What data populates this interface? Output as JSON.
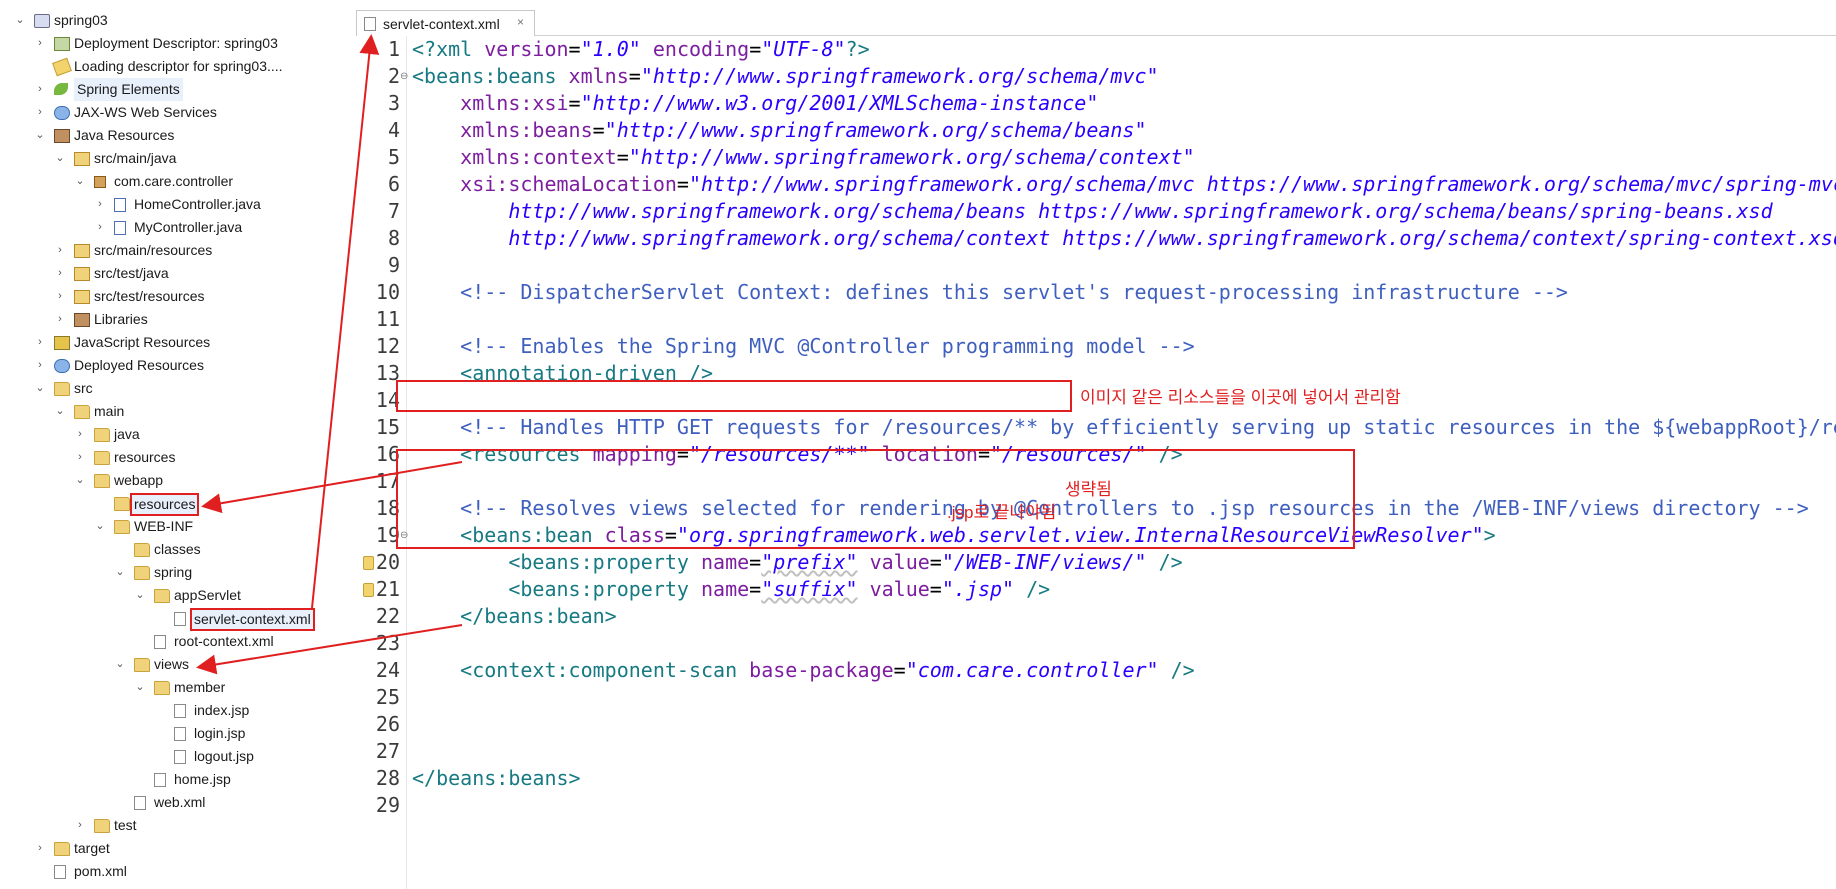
{
  "explorer": {
    "items": [
      {
        "label": "spring03",
        "depth": 0,
        "chev": "v",
        "icon": "project"
      },
      {
        "label": "Deployment Descriptor: spring03",
        "depth": 1,
        "chev": ">",
        "icon": "desc"
      },
      {
        "label": "Loading descriptor for spring03....",
        "depth": 1,
        "chev": "",
        "icon": "warn"
      },
      {
        "label": "Spring Elements",
        "depth": 1,
        "chev": ">",
        "icon": "leaf",
        "selected": true
      },
      {
        "label": "JAX-WS Web Services",
        "depth": 1,
        "chev": ">",
        "icon": "globe"
      },
      {
        "label": "Java Resources",
        "depth": 1,
        "chev": "v",
        "icon": "lib"
      },
      {
        "label": "src/main/java",
        "depth": 2,
        "chev": "v",
        "icon": "srcfolder"
      },
      {
        "label": "com.care.controller",
        "depth": 3,
        "chev": "v",
        "icon": "package"
      },
      {
        "label": "HomeController.java",
        "depth": 4,
        "chev": ">",
        "icon": "java"
      },
      {
        "label": "MyController.java",
        "depth": 4,
        "chev": ">",
        "icon": "java"
      },
      {
        "label": "src/main/resources",
        "depth": 2,
        "chev": ">",
        "icon": "srcfolder"
      },
      {
        "label": "src/test/java",
        "depth": 2,
        "chev": ">",
        "icon": "srcfolder"
      },
      {
        "label": "src/test/resources",
        "depth": 2,
        "chev": ">",
        "icon": "srcfolder"
      },
      {
        "label": "Libraries",
        "depth": 2,
        "chev": ">",
        "icon": "lib"
      },
      {
        "label": "JavaScript Resources",
        "depth": 1,
        "chev": ">",
        "icon": "jsres"
      },
      {
        "label": "Deployed Resources",
        "depth": 1,
        "chev": ">",
        "icon": "globe"
      },
      {
        "label": "src",
        "depth": 1,
        "chev": "v",
        "icon": "folder"
      },
      {
        "label": "main",
        "depth": 2,
        "chev": "v",
        "icon": "folder"
      },
      {
        "label": "java",
        "depth": 3,
        "chev": ">",
        "icon": "folder"
      },
      {
        "label": "resources",
        "depth": 3,
        "chev": ">",
        "icon": "folder"
      },
      {
        "label": "webapp",
        "depth": 3,
        "chev": "v",
        "icon": "folder"
      },
      {
        "label": "resources",
        "depth": 4,
        "chev": "",
        "icon": "folder",
        "highlight": true
      },
      {
        "label": "WEB-INF",
        "depth": 4,
        "chev": "v",
        "icon": "folder"
      },
      {
        "label": "classes",
        "depth": 5,
        "chev": "",
        "icon": "folder"
      },
      {
        "label": "spring",
        "depth": 5,
        "chev": "v",
        "icon": "folder"
      },
      {
        "label": "appServlet",
        "depth": 6,
        "chev": "v",
        "icon": "folder"
      },
      {
        "label": "servlet-context.xml",
        "depth": 7,
        "chev": "",
        "icon": "xml",
        "highlight": true
      },
      {
        "label": "root-context.xml",
        "depth": 6,
        "chev": "",
        "icon": "xml"
      },
      {
        "label": "views",
        "depth": 5,
        "chev": "v",
        "icon": "folder"
      },
      {
        "label": "member",
        "depth": 6,
        "chev": "v",
        "icon": "folder"
      },
      {
        "label": "index.jsp",
        "depth": 7,
        "chev": "",
        "icon": "jsp"
      },
      {
        "label": "login.jsp",
        "depth": 7,
        "chev": "",
        "icon": "jsp"
      },
      {
        "label": "logout.jsp",
        "depth": 7,
        "chev": "",
        "icon": "jsp"
      },
      {
        "label": "home.jsp",
        "depth": 6,
        "chev": "",
        "icon": "jsp"
      },
      {
        "label": "web.xml",
        "depth": 5,
        "chev": "",
        "icon": "xml"
      },
      {
        "label": "test",
        "depth": 3,
        "chev": ">",
        "icon": "folder"
      },
      {
        "label": "target",
        "depth": 1,
        "chev": ">",
        "icon": "folder"
      },
      {
        "label": "pom.xml",
        "depth": 1,
        "chev": "",
        "icon": "xml"
      }
    ]
  },
  "editor": {
    "tab_label": "servlet-context.xml",
    "tab_close": "×",
    "lines": [
      {
        "n": "1",
        "parts": [
          [
            "tag",
            "<?xml "
          ],
          [
            "attr",
            "version"
          ],
          [
            "eq",
            "="
          ],
          [
            "val",
            "\"1.0\""
          ],
          [
            "eq",
            " "
          ],
          [
            "attr",
            "encoding"
          ],
          [
            "eq",
            "="
          ],
          [
            "val",
            "\"UTF-8\""
          ],
          [
            "tag",
            "?>"
          ]
        ]
      },
      {
        "n": "2",
        "fold": "⊖",
        "parts": [
          [
            "tag",
            "<beans:beans "
          ],
          [
            "attr",
            "xmlns"
          ],
          [
            "eq",
            "="
          ],
          [
            "val",
            "\"http://www.springframework.org/schema/mvc\""
          ]
        ]
      },
      {
        "n": "3",
        "parts": [
          [
            "eq",
            "    "
          ],
          [
            "attr",
            "xmlns:xsi"
          ],
          [
            "eq",
            "="
          ],
          [
            "val",
            "\"http://www.w3.org/2001/XMLSchema-instance\""
          ]
        ]
      },
      {
        "n": "4",
        "parts": [
          [
            "eq",
            "    "
          ],
          [
            "attr",
            "xmlns:beans"
          ],
          [
            "eq",
            "="
          ],
          [
            "val",
            "\"http://www.springframework.org/schema/beans\""
          ]
        ]
      },
      {
        "n": "5",
        "parts": [
          [
            "eq",
            "    "
          ],
          [
            "attr",
            "xmlns:context"
          ],
          [
            "eq",
            "="
          ],
          [
            "val",
            "\"http://www.springframework.org/schema/context\""
          ]
        ]
      },
      {
        "n": "6",
        "parts": [
          [
            "eq",
            "    "
          ],
          [
            "attr",
            "xsi:schemaLocation"
          ],
          [
            "eq",
            "="
          ],
          [
            "val",
            "\"http://www.springframework.org/schema/mvc https://www.springframework.org/schema/mvc/spring-mvc.xsd"
          ]
        ]
      },
      {
        "n": "7",
        "parts": [
          [
            "val",
            "        http://www.springframework.org/schema/beans https://www.springframework.org/schema/beans/spring-beans.xsd"
          ]
        ]
      },
      {
        "n": "8",
        "parts": [
          [
            "val",
            "        http://www.springframework.org/schema/context https://www.springframework.org/schema/context/spring-context.xsd\">"
          ]
        ]
      },
      {
        "n": "9",
        "parts": []
      },
      {
        "n": "10",
        "parts": [
          [
            "cmt",
            "    <!-- DispatcherServlet Context: defines this servlet's request-processing infrastructure -->"
          ]
        ]
      },
      {
        "n": "11",
        "parts": []
      },
      {
        "n": "12",
        "parts": [
          [
            "cmt",
            "    <!-- Enables the Spring MVC @Controller programming model -->"
          ]
        ]
      },
      {
        "n": "13",
        "parts": [
          [
            "tag",
            "    <annotation-driven />"
          ]
        ]
      },
      {
        "n": "14",
        "parts": []
      },
      {
        "n": "15",
        "parts": [
          [
            "cmt",
            "    <!-- Handles HTTP GET requests for /resources/** by efficiently serving up static resources in the ${webappRoot}/resources directory -->"
          ]
        ]
      },
      {
        "n": "16",
        "parts": [
          [
            "tag",
            "    <resources "
          ],
          [
            "attr",
            "mapping"
          ],
          [
            "eq",
            "="
          ],
          [
            "val",
            "\"/resources/**\""
          ],
          [
            "eq",
            " "
          ],
          [
            "attr",
            "location"
          ],
          [
            "eq",
            "="
          ],
          [
            "val",
            "\"/resources/\""
          ],
          [
            "tag",
            " />"
          ]
        ]
      },
      {
        "n": "17",
        "parts": []
      },
      {
        "n": "18",
        "parts": [
          [
            "cmt",
            "    <!-- Resolves views selected for rendering by @Controllers to .jsp resources in the /WEB-INF/views directory -->"
          ]
        ]
      },
      {
        "n": "19",
        "fold": "⊖",
        "parts": [
          [
            "tag",
            "    <beans:bean "
          ],
          [
            "attr",
            "class"
          ],
          [
            "eq",
            "="
          ],
          [
            "val",
            "\"org.springframework.web.servlet.view.InternalResourceViewResolver\""
          ],
          [
            "tag",
            ">"
          ]
        ]
      },
      {
        "n": "20",
        "marker": true,
        "parts": [
          [
            "tag",
            "        <beans:property "
          ],
          [
            "attr",
            "name"
          ],
          [
            "eq",
            "="
          ],
          [
            "valsq",
            "\"prefix\""
          ],
          [
            "eq",
            " "
          ],
          [
            "attr",
            "value"
          ],
          [
            "eq",
            "="
          ],
          [
            "val",
            "\"/WEB-INF/views/\""
          ],
          [
            "tag",
            " />"
          ]
        ]
      },
      {
        "n": "21",
        "marker": true,
        "parts": [
          [
            "tag",
            "        <beans:property "
          ],
          [
            "attr",
            "name"
          ],
          [
            "eq",
            "="
          ],
          [
            "valsq",
            "\"suffix\""
          ],
          [
            "eq",
            " "
          ],
          [
            "attr",
            "value"
          ],
          [
            "eq",
            "="
          ],
          [
            "val",
            "\".jsp\""
          ],
          [
            "tag",
            " />"
          ]
        ]
      },
      {
        "n": "22",
        "parts": [
          [
            "tag",
            "    </beans:bean>"
          ]
        ]
      },
      {
        "n": "23",
        "parts": []
      },
      {
        "n": "24",
        "parts": [
          [
            "tag",
            "    <context:component-scan "
          ],
          [
            "attr",
            "base-package"
          ],
          [
            "eq",
            "="
          ],
          [
            "val",
            "\"com.care.controller\""
          ],
          [
            "tag",
            " />"
          ]
        ]
      },
      {
        "n": "25",
        "parts": []
      },
      {
        "n": "26",
        "parts": []
      },
      {
        "n": "27",
        "parts": []
      },
      {
        "n": "28",
        "parts": [
          [
            "tag",
            "</beans:beans>"
          ]
        ]
      },
      {
        "n": "29",
        "parts": []
      }
    ]
  },
  "annotations": {
    "resources_note": "이미지 같은 리소스들을 이곳에 넣어서 관리함",
    "prefix_note": "생략됨",
    "suffix_note": ".jsp로 끝나야됨"
  },
  "colors": {
    "annotation": "#e02020",
    "tag": "#177a82",
    "attr": "#7d1ea0",
    "value": "#2a00ff",
    "comment": "#3f5fbf"
  }
}
